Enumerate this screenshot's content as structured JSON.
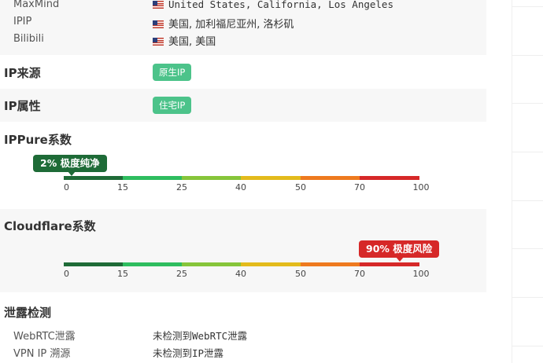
{
  "geo": {
    "rows": [
      {
        "label": "MaxMind",
        "value": "United States, California, Los Angeles",
        "flag": "us-flag-icon"
      },
      {
        "label": "IPIP",
        "value": "美国, 加利福尼亚州, 洛杉矶",
        "flag": "us-flag-icon"
      },
      {
        "label": "Bilibili",
        "value": "美国, 美国",
        "flag": "us-flag-icon"
      }
    ]
  },
  "ip_source": {
    "title": "IP来源",
    "tag": "原生IP"
  },
  "ip_type": {
    "title": "IP属性",
    "tag": "住宅IP"
  },
  "ippure": {
    "title": "IPPure系数",
    "badge": "2% 极度纯净",
    "value_percent": 2
  },
  "cloudflare": {
    "title": "Cloudflare系数",
    "badge": "90% 极度风险",
    "value_percent": 90
  },
  "scale": {
    "ticks": [
      "0",
      "15",
      "25",
      "40",
      "50",
      "70",
      "100"
    ],
    "colors": [
      "#1e6b37",
      "#2ebd5f",
      "#86c53a",
      "#e3bb1c",
      "#ee7a1f",
      "#d62828"
    ]
  },
  "leak": {
    "title": "泄露检测",
    "rows": [
      {
        "label": "WebRTC泄露",
        "value": "未检测到WebRTC泄露"
      },
      {
        "label": "VPN IP 溯源",
        "value": "未检测到IP泄露"
      }
    ]
  },
  "colors": {
    "tag_green": "#4cc38a",
    "badge_green": "#1e6b37",
    "badge_red": "#d62828"
  }
}
